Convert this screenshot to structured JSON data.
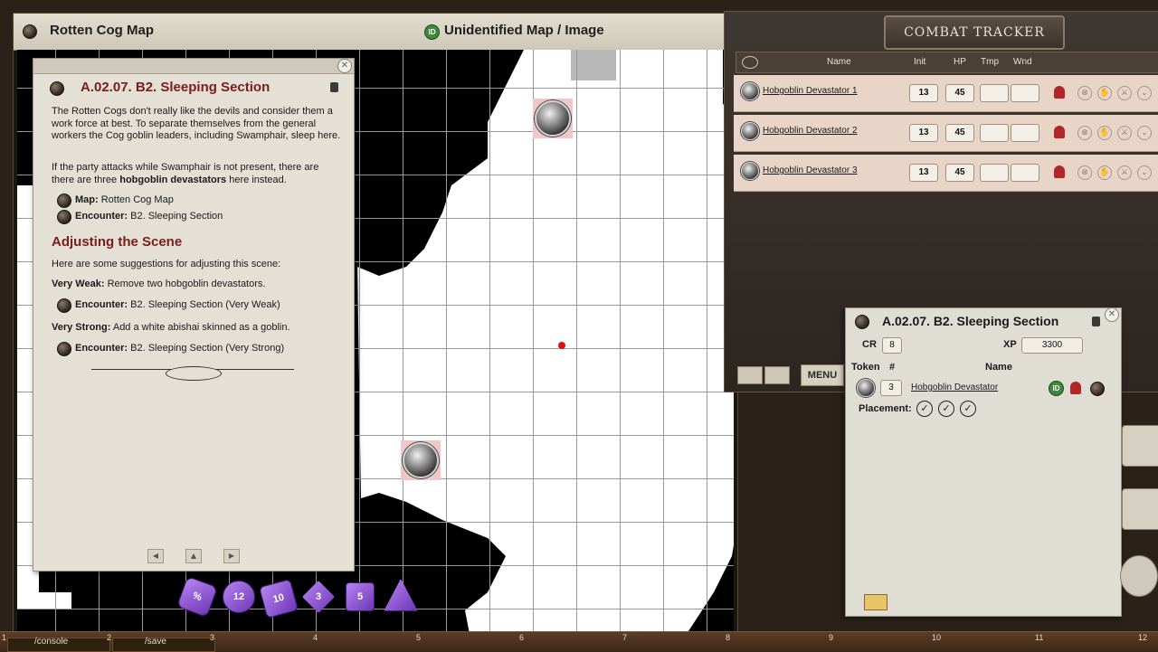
{
  "map": {
    "title": "Rotten Cog Map",
    "subtitle": "Unidentified Map / Image",
    "id_badge": "ID"
  },
  "story": {
    "heading": "A.02.07. B2. Sleeping Section",
    "paragraph1": "The Rotten Cogs don't really like the devils and consider them a work force at best. To separate themselves from the general workers the Cog goblin leaders, including Swamphair, sleep here.",
    "paragraph2_a": "If the party attacks while Swamphair is not present, there are there are three ",
    "paragraph2_bold": "hobgoblin devastators",
    "paragraph2_b": " here instead.",
    "links": [
      {
        "label": "Map:",
        "value": "Rotten Cog Map"
      },
      {
        "label": "Encounter:",
        "value": "B2. Sleeping Section"
      }
    ],
    "section_heading": "Adjusting the Scene",
    "suggestions_intro": "Here are some suggestions for adjusting this scene:",
    "very_weak_label": "Very Weak:",
    "very_weak_text": " Remove two hobgoblin devastators.",
    "very_weak_link_label": "Encounter:",
    "very_weak_link_value": "B2. Sleeping Section (Very Weak)",
    "very_strong_label": "Very Strong:",
    "very_strong_text": " Add a white abishai skinned as a goblin.",
    "very_strong_link_label": "Encounter:",
    "very_strong_link_value": "B2. Sleeping Section (Very Strong)",
    "nav": [
      "◀",
      "▲",
      "▶"
    ]
  },
  "dice": [
    {
      "label": "%",
      "type": "d100"
    },
    {
      "label": "12",
      "type": "d12"
    },
    {
      "label": "10",
      "type": "d10"
    },
    {
      "label": "3",
      "type": "d8"
    },
    {
      "label": "5",
      "type": "d6"
    },
    {
      "label": "",
      "type": "d4"
    }
  ],
  "combat_tracker": {
    "title": "COMBAT TRACKER",
    "columns": {
      "name": "Name",
      "init": "Init",
      "hp": "HP",
      "tmp": "Tmp",
      "wnd": "Wnd"
    },
    "rows": [
      {
        "name": "Hobgoblin Devastator 1",
        "init": "13",
        "hp": "45",
        "tmp": "",
        "wnd": ""
      },
      {
        "name": "Hobgoblin Devastator 2",
        "init": "13",
        "hp": "45",
        "tmp": "",
        "wnd": ""
      },
      {
        "name": "Hobgoblin Devastator 3",
        "init": "13",
        "hp": "45",
        "tmp": "",
        "wnd": ""
      }
    ],
    "menu_label": "MENU",
    "colors": {
      "row_bg": "#e8d5c8",
      "helm": "#b22626"
    }
  },
  "encounter": {
    "title": "A.02.07. B2. Sleeping Section",
    "cr_label": "CR",
    "cr": "8",
    "xp_label": "XP",
    "xp": "3300",
    "token_col": "Token",
    "count_col": "#",
    "name_col": "Name",
    "entry": {
      "count": "3",
      "name": "Hobgoblin Devastator",
      "id_badge": "ID"
    },
    "placement_label": "Placement:",
    "placements": [
      "✓",
      "✓",
      "✓"
    ]
  },
  "hotbar": {
    "slot1": "/console",
    "slot2": "/save",
    "numbers": [
      "1",
      "2",
      "3",
      "4",
      "5",
      "6",
      "7",
      "8",
      "9",
      "10",
      "11",
      "12"
    ]
  }
}
